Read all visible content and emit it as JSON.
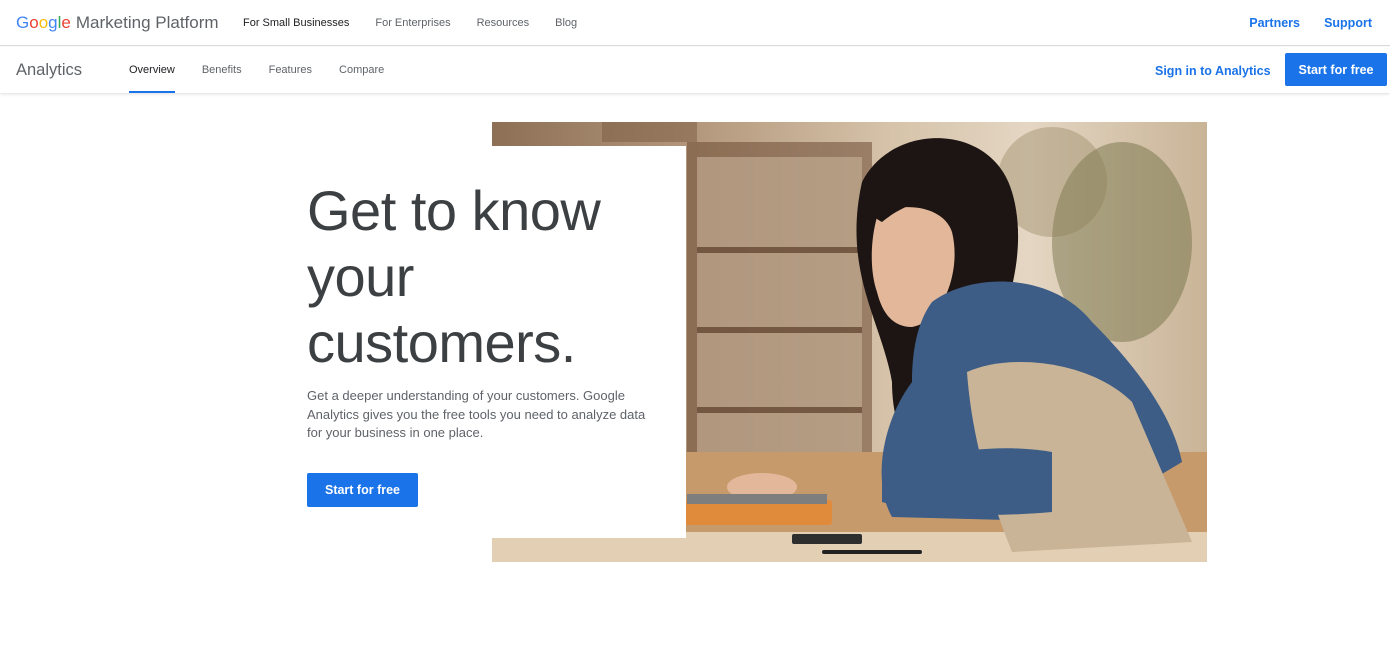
{
  "brand": {
    "google": [
      "G",
      "o",
      "o",
      "g",
      "l",
      "e"
    ],
    "google_colors": [
      "#4285F4",
      "#EA4335",
      "#FBBC05",
      "#4285F4",
      "#34A853",
      "#EA4335"
    ],
    "platform": "Marketing Platform"
  },
  "top_nav": {
    "items": [
      "For Small Businesses",
      "For Enterprises",
      "Resources",
      "Blog"
    ],
    "active": "For Small Businesses"
  },
  "top_links": {
    "partners": "Partners",
    "support": "Support"
  },
  "sub_nav": {
    "product": "Analytics",
    "tabs": [
      "Overview",
      "Benefits",
      "Features",
      "Compare"
    ],
    "active_tab": "Overview",
    "sign_in": "Sign in to Analytics",
    "cta": "Start for free"
  },
  "hero": {
    "headline": [
      "Get to know",
      "your",
      "customers."
    ],
    "body": "Get a deeper understanding of your customers. Google Analytics gives you the free tools you need to analyze data for your business in one place.",
    "cta": "Start for free",
    "image_icon": "woman-typing-on-laptop-photo"
  },
  "colors": {
    "accent": "#1a73e8",
    "text": "#3c4043",
    "muted": "#5f6368"
  }
}
